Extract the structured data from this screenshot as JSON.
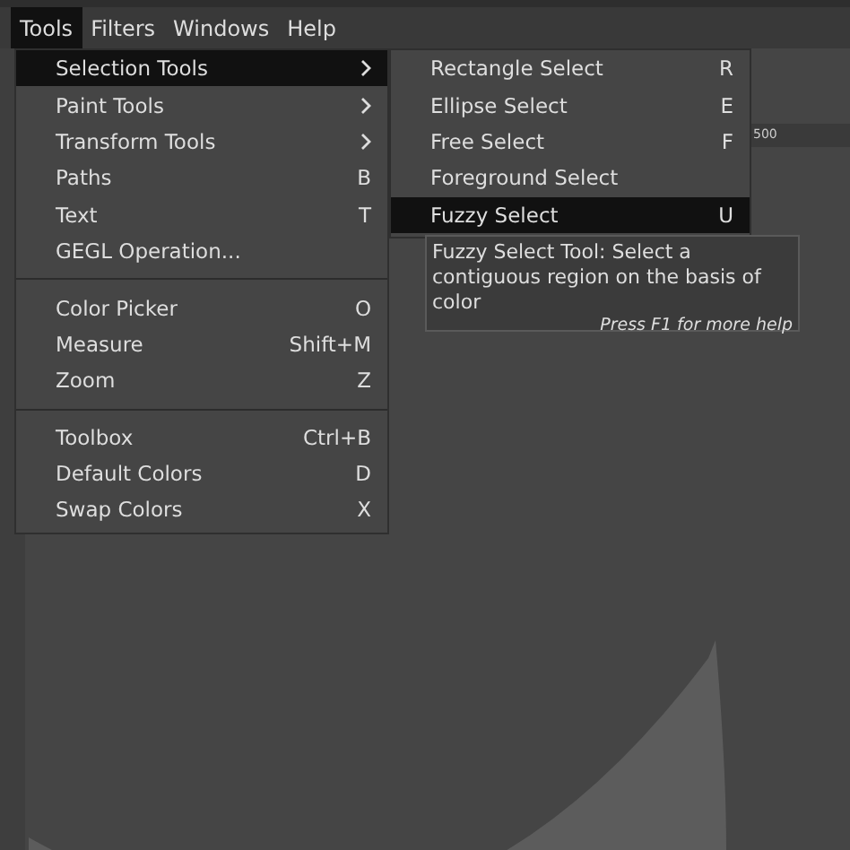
{
  "menubar": [
    {
      "label": "Tools",
      "selected": true
    },
    {
      "label": "Filters",
      "selected": false
    },
    {
      "label": "Windows",
      "selected": false
    },
    {
      "label": "Help",
      "selected": false
    }
  ],
  "menu": [
    {
      "kind": "submenu",
      "label": "Selection Tools",
      "selected": true
    },
    {
      "kind": "submenu",
      "label": "Paint Tools",
      "selected": false
    },
    {
      "kind": "submenu",
      "label": "Transform Tools",
      "selected": false
    },
    {
      "kind": "item",
      "label": "Paths",
      "shortcut": "B",
      "selected": false
    },
    {
      "kind": "item",
      "label": "Text",
      "shortcut": "T",
      "selected": false
    },
    {
      "kind": "item",
      "label": "GEGL Operation...",
      "selected": false
    },
    {
      "kind": "separator"
    },
    {
      "kind": "item",
      "label": "Color Picker",
      "shortcut": "O",
      "selected": false
    },
    {
      "kind": "item",
      "label": "Measure",
      "shortcut": "Shift+M",
      "selected": false
    },
    {
      "kind": "item",
      "label": "Zoom",
      "shortcut": "Z",
      "selected": false
    },
    {
      "kind": "separator"
    },
    {
      "kind": "item",
      "label": "Toolbox",
      "shortcut": "Ctrl+B",
      "selected": false
    },
    {
      "kind": "item",
      "label": "Default Colors",
      "shortcut": "D",
      "selected": false
    },
    {
      "kind": "item",
      "label": "Swap Colors",
      "shortcut": "X",
      "selected": false
    }
  ],
  "submenu": [
    {
      "kind": "item",
      "label": "Rectangle Select",
      "shortcut": "R",
      "selected": false
    },
    {
      "kind": "item",
      "label": "Ellipse Select",
      "shortcut": "E",
      "selected": false
    },
    {
      "kind": "item",
      "label": "Free Select",
      "shortcut": "F",
      "selected": false
    },
    {
      "kind": "item",
      "label": "Foreground Select",
      "selected": false
    },
    {
      "kind": "item",
      "label": "Fuzzy Select",
      "shortcut": "U",
      "selected": true
    }
  ],
  "tooltip": {
    "text": "Fuzzy Select Tool: Select a contiguous region on the basis of color",
    "help": "Press F1 for more help"
  },
  "ruler": {
    "label": "500"
  }
}
